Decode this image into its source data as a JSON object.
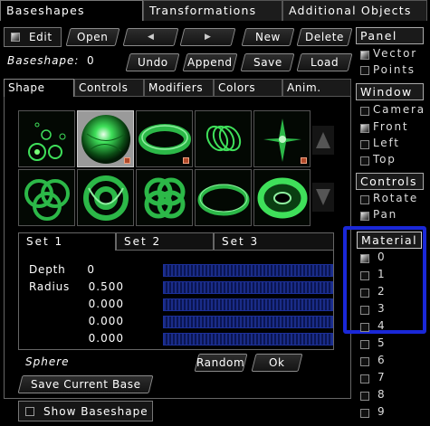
{
  "tabs": [
    "Baseshapes",
    "Transformations",
    "Additional Objects"
  ],
  "toolbar": {
    "edit": "Edit",
    "open": "Open",
    "prev": "◀",
    "next": "▶",
    "new": "New",
    "delete": "Delete",
    "baseshape_label": "Baseshape:",
    "baseshape_value": "0",
    "undo": "Undo",
    "append": "Append",
    "save": "Save",
    "load": "Load"
  },
  "shape_tabs": [
    "Shape",
    "Controls",
    "Modifiers",
    "Colors",
    "Anim."
  ],
  "set_tabs": [
    "Set 1",
    "Set 2",
    "Set 3"
  ],
  "params": [
    {
      "label": "Depth",
      "value": "0"
    },
    {
      "label": "Radius",
      "value": "0.500"
    },
    {
      "label": "",
      "value": "0.000"
    },
    {
      "label": "",
      "value": "0.000"
    },
    {
      "label": "",
      "value": "0.000"
    }
  ],
  "shape_name": "Sphere",
  "random_label": "Random",
  "ok_label": "Ok",
  "save_base_label": "Save Current Base",
  "show_baseshape_label": "Show Baseshape",
  "panel": {
    "title": "Panel",
    "items": [
      {
        "label": "Vector",
        "checked": true
      },
      {
        "label": "Points",
        "checked": false
      }
    ]
  },
  "window": {
    "title": "Window",
    "items": [
      {
        "label": "Camera",
        "checked": false
      },
      {
        "label": "Front",
        "checked": true
      },
      {
        "label": "Left",
        "checked": false
      },
      {
        "label": "Top",
        "checked": false
      }
    ]
  },
  "controls": {
    "title": "Controls",
    "items": [
      {
        "label": "Rotate",
        "checked": false
      },
      {
        "label": "Pan",
        "checked": true
      }
    ]
  },
  "material": {
    "title": "Material",
    "items": [
      {
        "label": "0",
        "checked": true
      },
      {
        "label": "1",
        "checked": false
      },
      {
        "label": "2",
        "checked": false
      },
      {
        "label": "3",
        "checked": false
      },
      {
        "label": "4",
        "checked": false
      },
      {
        "label": "5",
        "checked": false
      },
      {
        "label": "6",
        "checked": false
      },
      {
        "label": "7",
        "checked": false
      },
      {
        "label": "8",
        "checked": false
      },
      {
        "label": "9",
        "checked": false
      }
    ]
  },
  "colors": {
    "highlight": "#1a28d8",
    "slider": "#1a2c88",
    "glow": "#3fe05a"
  }
}
